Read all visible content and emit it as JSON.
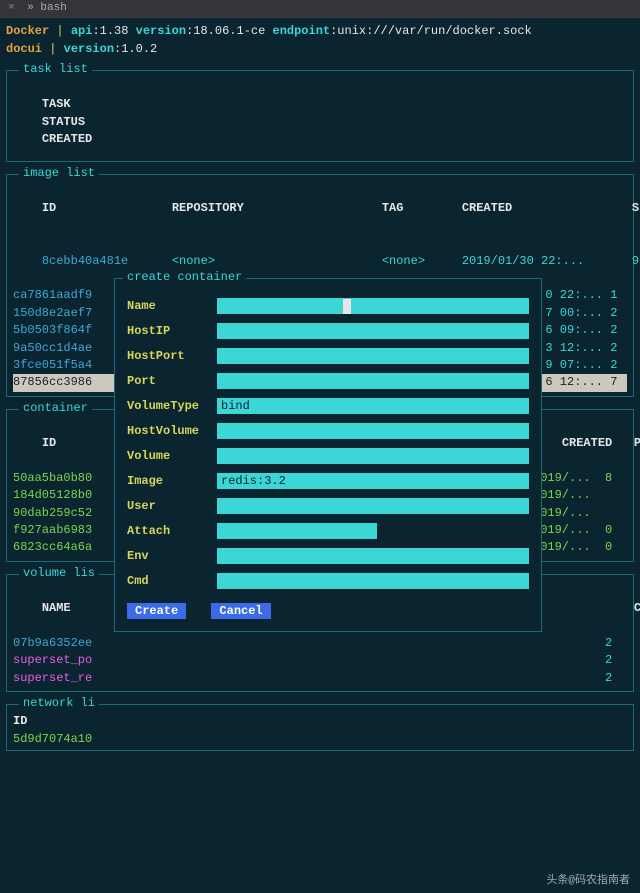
{
  "titlebar": {
    "left": "×",
    "tab": "» bash"
  },
  "header": {
    "l1a": "Docker",
    "l1sep": " | ",
    "l1b": "api",
    "l1bv": ":1.38",
    "l1c": "version",
    "l1cv": ":18.06.1-ce ",
    "l1d": "endpoint",
    "l1dv": ":unix:///var/run/docker.sock",
    "l2a": "docui",
    "l2sep": "  | ",
    "l2b": "version",
    "l2bv": ":1.0.2"
  },
  "tasks": {
    "title": "task list",
    "h_task": "TASK",
    "h_status": "STATUS",
    "h_created": "CREATED"
  },
  "images": {
    "title": "image list",
    "h_id": "ID",
    "h_repo": "REPOSITORY",
    "h_tag": "TAG",
    "h_created": "CREATED",
    "h_s": "S",
    "rows": [
      {
        "id": "8cebb40a481e",
        "repo": "<none>",
        "tag": "<none>",
        "created": "2019/01/30 22:...",
        "s": "9"
      },
      {
        "id": "ca7861aadf9",
        "created_r": "0 22:...",
        "s": "1"
      },
      {
        "id": "150d8e2aef7",
        "created_r": "7 00:...",
        "s": "2"
      },
      {
        "id": "5b0503f864f",
        "created_r": "6 09:...",
        "s": "2"
      },
      {
        "id": "9a50cc1d4ae",
        "created_r": "3 12:...",
        "s": "2"
      },
      {
        "id": "3fce051f5a4",
        "created_r": "9 07:...",
        "s": "2"
      },
      {
        "id": "87856cc3986",
        "created_r": "6 12:...",
        "s": "7"
      }
    ]
  },
  "containers": {
    "title": "container",
    "h_id": "ID",
    "h_created": "CREATED",
    "h_p": "P",
    "rows": [
      {
        "id": "50aa5ba0b80",
        "created": "2019/...",
        "p": "8"
      },
      {
        "id": "184d05128b0",
        "created": "2019/...",
        "p": ""
      },
      {
        "id": "90dab259c52",
        "created": "2019/...",
        "p": ""
      },
      {
        "id": "f927aab6983",
        "created": "2019/...",
        "p": "0"
      },
      {
        "id": "6823cc64a6a",
        "created": "2019/...",
        "p": "0"
      }
    ]
  },
  "volumes": {
    "title": "volume lis",
    "h_name": "NAME",
    "h_c": "C",
    "rows": [
      {
        "name": "07b9a6352ee",
        "c": "2"
      },
      {
        "name": "superset_po",
        "c": "2"
      },
      {
        "name": "superset_re",
        "c": "2"
      }
    ]
  },
  "networks": {
    "title": "network li",
    "h_id": "ID",
    "rows": [
      {
        "id": "5d9d7074a10"
      }
    ]
  },
  "modal": {
    "title": "create container",
    "fields": {
      "name": {
        "label": "Name",
        "value": ""
      },
      "hostip": {
        "label": "HostIP",
        "value": ""
      },
      "hostport": {
        "label": "HostPort",
        "value": ""
      },
      "port": {
        "label": "Port",
        "value": ""
      },
      "volumetype": {
        "label": "VolumeType",
        "value": "bind"
      },
      "hostvolume": {
        "label": "HostVolume",
        "value": ""
      },
      "volume": {
        "label": "Volume",
        "value": ""
      },
      "image": {
        "label": "Image",
        "value": "redis:3.2"
      },
      "user": {
        "label": "User",
        "value": ""
      },
      "attach": {
        "label": "Attach",
        "value": ""
      },
      "env": {
        "label": "Env",
        "value": ""
      },
      "cmd": {
        "label": "Cmd",
        "value": ""
      }
    },
    "btn_create": "Create",
    "btn_cancel": "Cancel"
  },
  "watermark": "头条@码农指南者"
}
